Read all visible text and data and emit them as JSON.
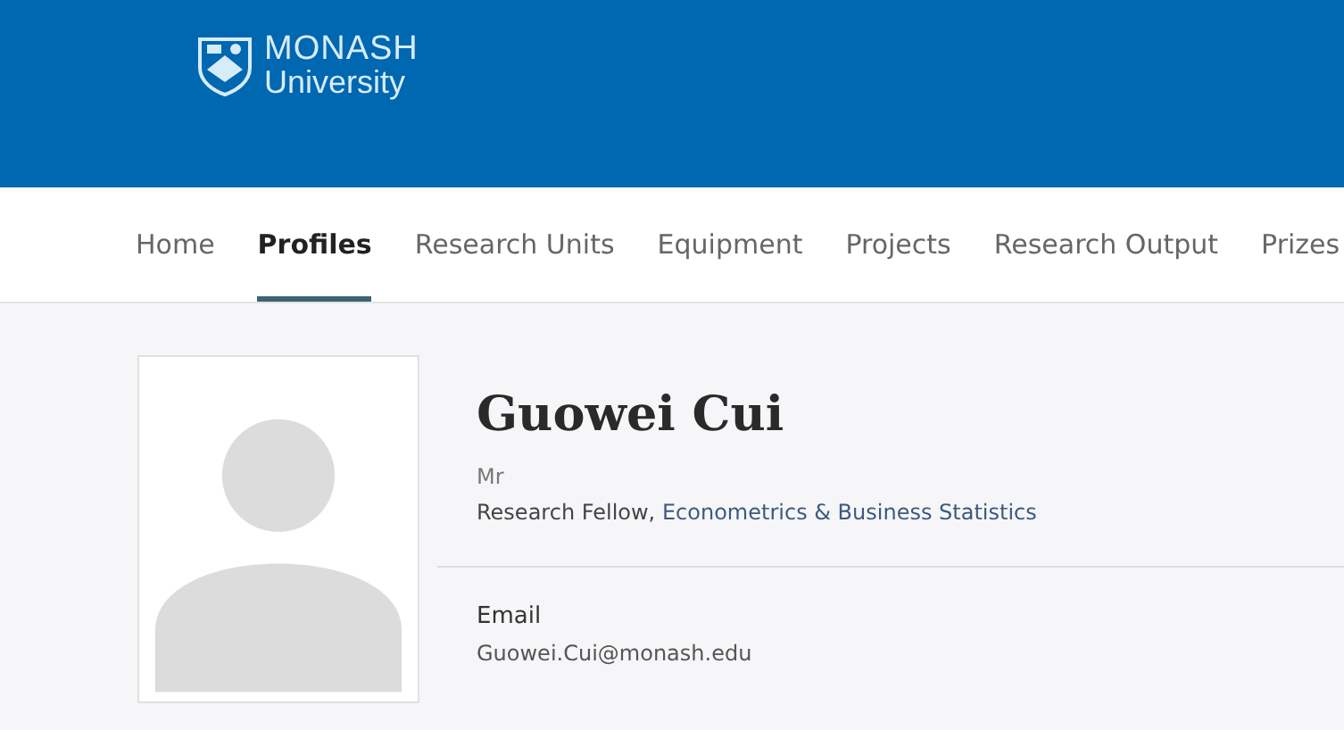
{
  "header": {
    "logo": {
      "line_1": "MONASH",
      "line_2": "University"
    }
  },
  "nav": {
    "tabs": [
      {
        "label": "Home",
        "selected": false
      },
      {
        "label": "Profiles",
        "selected": true
      },
      {
        "label": "Research Units",
        "selected": false
      },
      {
        "label": "Equipment",
        "selected": false
      },
      {
        "label": "Projects",
        "selected": false
      },
      {
        "label": "Research Output",
        "selected": false
      },
      {
        "label": "Prizes",
        "selected": false
      }
    ]
  },
  "profile": {
    "name": "Guowei Cui",
    "honorific": "Mr",
    "position": "Research Fellow,",
    "department": "Econometrics & Business Statistics",
    "contact": {
      "label": "Email",
      "value": "Guowei.Cui@monash.edu"
    }
  }
}
